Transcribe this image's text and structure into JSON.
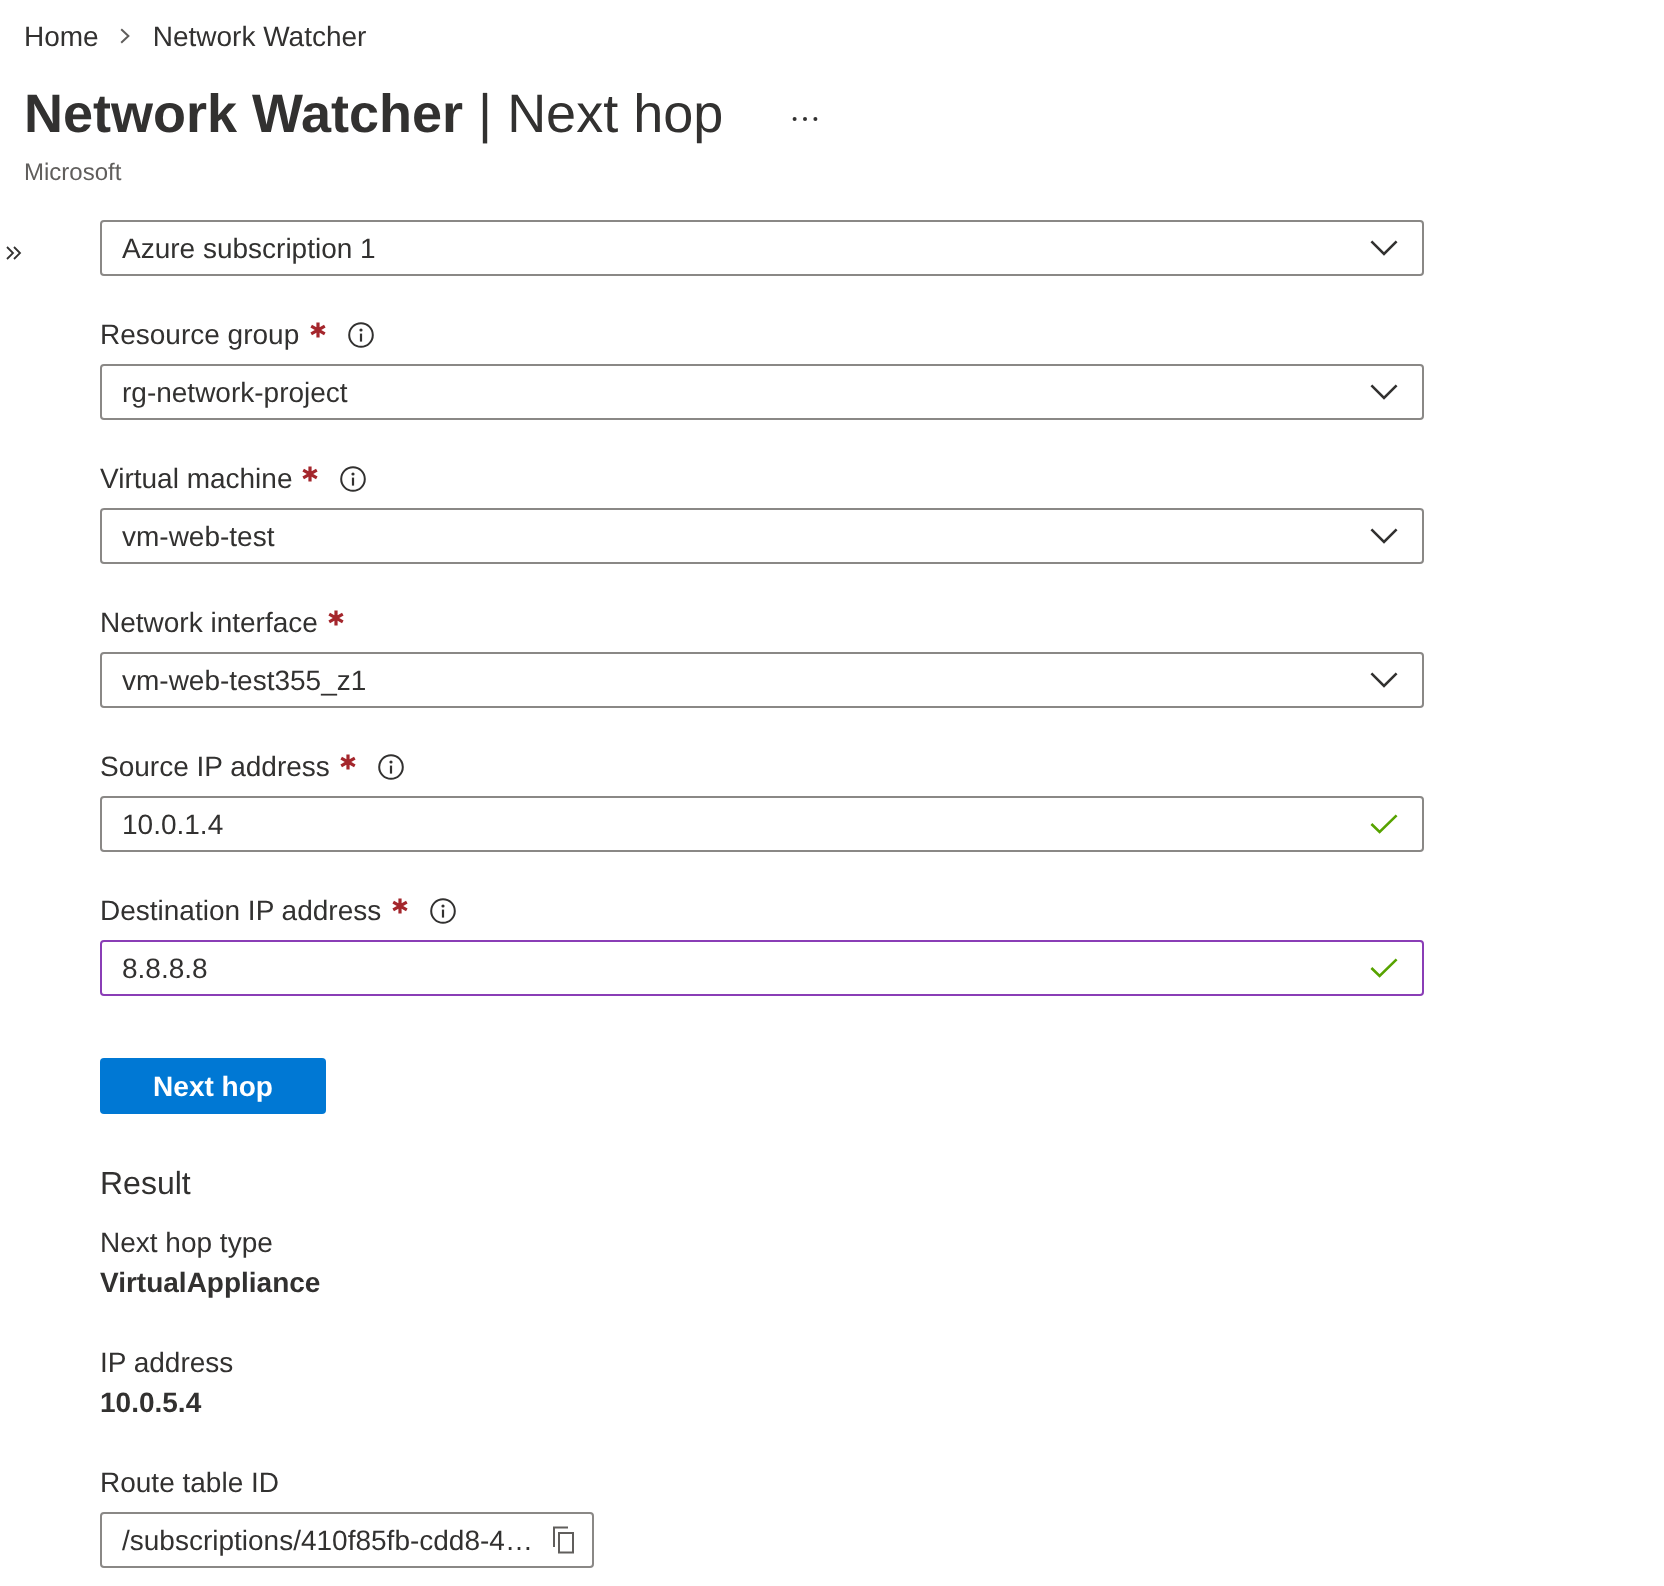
{
  "breadcrumb": [
    {
      "label": "Home"
    },
    {
      "label": "Network Watcher"
    }
  ],
  "header": {
    "title": "**Network Watcher** | Next hop",
    "publisher": "Microsoft"
  },
  "form": {
    "fields": [
      {
        "kind": "dropdown",
        "value": "Azure subscription 1"
      },
      {
        "kind": "dropdown",
        "label": "Resource group",
        "required": true,
        "info": true,
        "value": "rg-network-project"
      },
      {
        "kind": "dropdown",
        "label": "Virtual machine",
        "required": true,
        "info": true,
        "value": "vm-web-test"
      },
      {
        "kind": "dropdown",
        "label": "Network interface",
        "required": true,
        "info": false,
        "value": "vm-web-test355_z1"
      },
      {
        "kind": "text",
        "label": "Source IP address",
        "required": true,
        "info": true,
        "value": "10.0.1.4",
        "valid": true,
        "focused": false
      },
      {
        "kind": "text",
        "label": "Destination IP address",
        "required": true,
        "info": true,
        "value": "8.8.8.8",
        "valid": true,
        "focused": true
      }
    ],
    "submit_button": "Next hop"
  },
  "result": {
    "heading": "Result",
    "items": [
      {
        "label": "Next hop type",
        "value": "VirtualAppliance"
      },
      {
        "label": "IP address",
        "value": "10.0.5.4"
      }
    ],
    "route_table": {
      "label": "Route table ID",
      "value": "/subscriptions/410f85fb-cdd8-4…"
    }
  }
}
